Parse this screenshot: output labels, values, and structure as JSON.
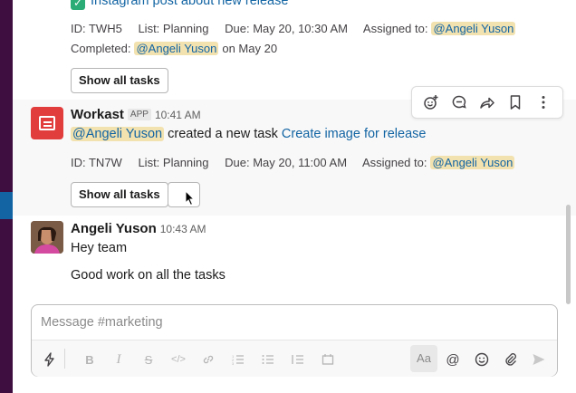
{
  "top_message": {
    "task_title": "Instagram post about new release",
    "meta": {
      "id": "ID: TWH5",
      "list": "List: Planning",
      "due": "Due: May 20, 10:30 AM",
      "assigned_label": "Assigned to:",
      "assigned_user": "@Angeli Yuson"
    },
    "completed_label": "Completed:",
    "completed_user": "@Angeli Yuson",
    "completed_date": "on May 20",
    "show_all_label": "Show all tasks"
  },
  "workast_message": {
    "sender": "Workast",
    "app_badge": "APP",
    "time": "10:41 AM",
    "mention": "@Angeli Yuson",
    "action_text": "created a new task",
    "task_link": "Create image for release",
    "meta": {
      "id": "ID: TN7W",
      "list": "List: Planning",
      "due": "Due: May 20, 11:00 AM",
      "assigned_label": "Assigned to:",
      "assigned_user": "@Angeli Yuson"
    },
    "show_all_label": "Show all tasks"
  },
  "hover_toolbar": {
    "icons": [
      "add-reaction-icon",
      "reply-in-thread-icon",
      "share-icon",
      "bookmark-icon",
      "more-actions-icon"
    ]
  },
  "angeli_message": {
    "sender": "Angeli Yuson",
    "time": "10:43 AM",
    "lines": [
      "Hey team",
      "Good work on all the tasks"
    ]
  },
  "composer": {
    "placeholder": "Message #marketing",
    "toolbar_icons": [
      "shortcuts-icon",
      "bold-icon",
      "italic-icon",
      "strikethrough-icon",
      "code-icon",
      "link-icon",
      "ordered-list-icon",
      "bulleted-list-icon",
      "blockquote-icon",
      "code-block-icon",
      "formatting-toggle-icon",
      "mention-icon",
      "emoji-icon",
      "attach-icon",
      "send-icon"
    ],
    "format_toggle_label": "Aa"
  },
  "colors": {
    "mention_bg": "#f2e2b0",
    "link": "#1264a3",
    "sidebar": "#3f0e40",
    "workast_red": "#e23d3d",
    "check_green": "#2bac76"
  }
}
